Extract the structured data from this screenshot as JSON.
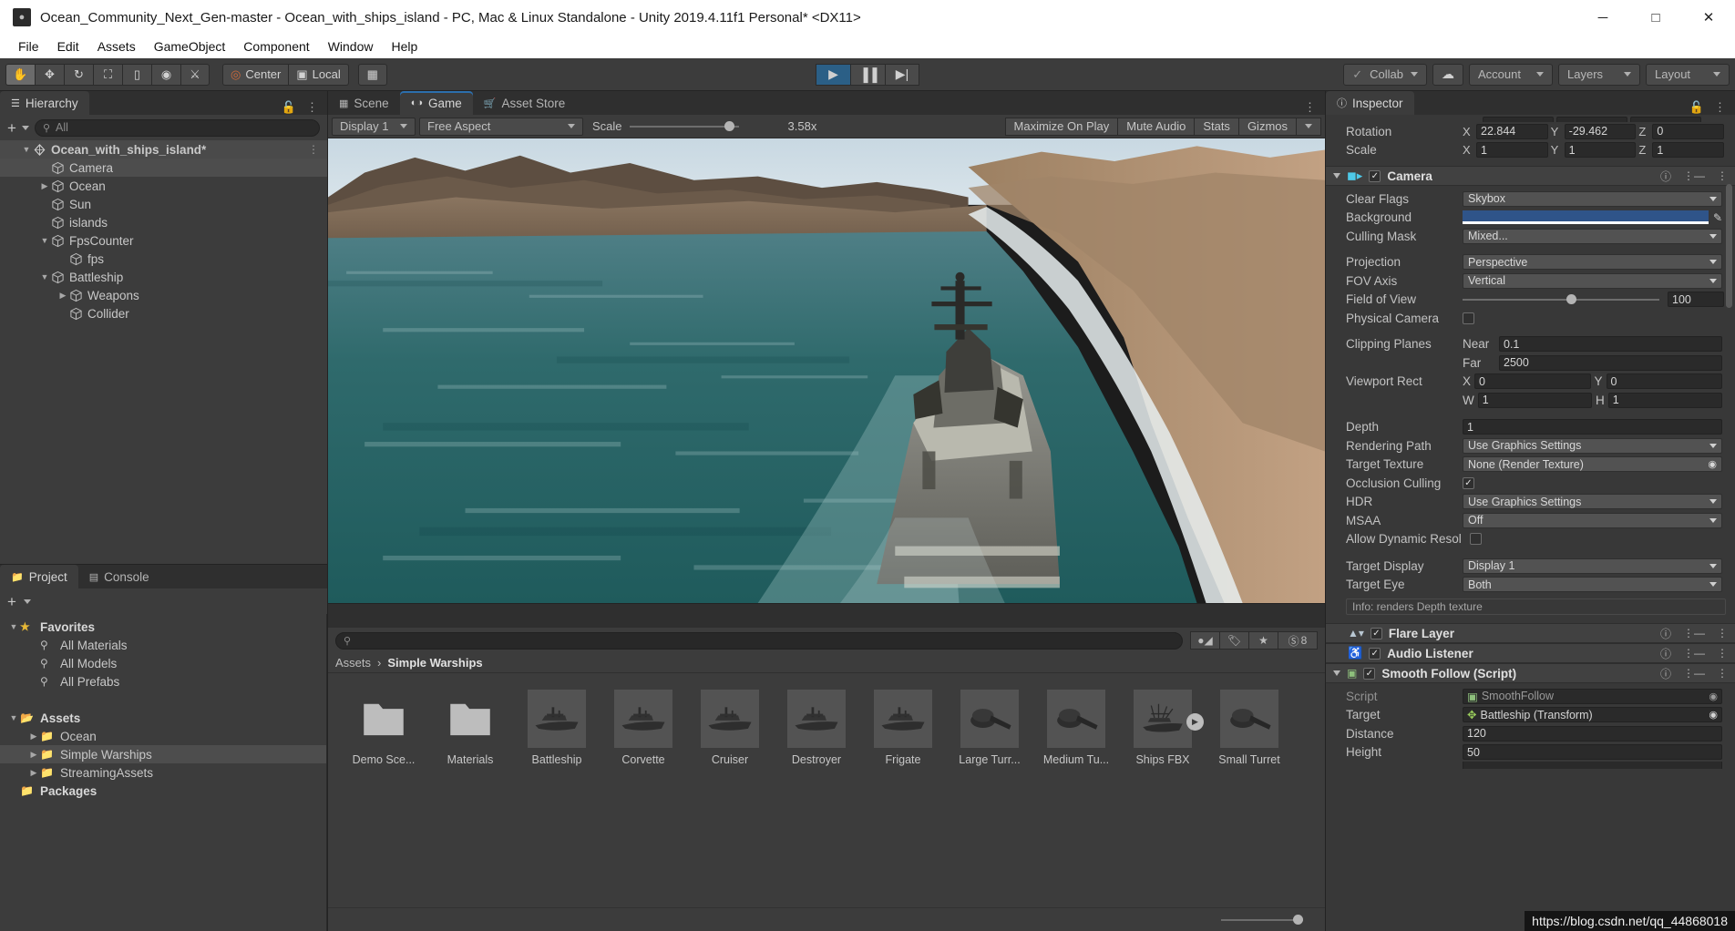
{
  "window": {
    "title": "Ocean_Community_Next_Gen-master - Ocean_with_ships_island - PC, Mac & Linux Standalone - Unity 2019.4.11f1 Personal* <DX11>",
    "minimize": "─",
    "maximize": "□",
    "close": "✕"
  },
  "menubar": {
    "items": [
      "File",
      "Edit",
      "Assets",
      "GameObject",
      "Component",
      "Window",
      "Help"
    ]
  },
  "toolbar": {
    "tools": [
      "hand-tool",
      "move-tool",
      "rotate-tool",
      "scale-tool",
      "rect-tool",
      "transform-tool",
      "custom-tool"
    ],
    "pivot_mode": "Center",
    "pivot_rotation": "Local",
    "grid_label": "",
    "play": "▶",
    "pause": "▐▐",
    "step": "▶|",
    "collab": "Collab",
    "cloud": "cloud",
    "account": "Account",
    "layers": "Layers",
    "layout": "Layout"
  },
  "hierarchy": {
    "tab": "Hierarchy",
    "search_placeholder": "All",
    "items": [
      {
        "label": "Ocean_with_ships_island*",
        "depth": 0,
        "arrow": "down",
        "selected": true,
        "bold": true
      },
      {
        "label": "Camera",
        "depth": 1,
        "arrow": "none",
        "selected": true
      },
      {
        "label": "Ocean",
        "depth": 1,
        "arrow": "right"
      },
      {
        "label": "Sun",
        "depth": 1,
        "arrow": "none"
      },
      {
        "label": "islands",
        "depth": 1,
        "arrow": "none"
      },
      {
        "label": "FpsCounter",
        "depth": 1,
        "arrow": "down"
      },
      {
        "label": "fps",
        "depth": 2,
        "arrow": "none"
      },
      {
        "label": "Battleship",
        "depth": 1,
        "arrow": "down"
      },
      {
        "label": "Weapons",
        "depth": 2,
        "arrow": "right"
      },
      {
        "label": "Collider",
        "depth": 2,
        "arrow": "none"
      }
    ]
  },
  "center_tabs": [
    {
      "label": "Scene",
      "icon": "grid-icon",
      "selected": false
    },
    {
      "label": "Game",
      "icon": "gamepad-icon",
      "selected": true
    },
    {
      "label": "Asset Store",
      "icon": "store-icon",
      "selected": false
    }
  ],
  "game_toolbar": {
    "display": "Display 1",
    "aspect": "Free Aspect",
    "scale_label": "Scale",
    "scale_value": "3.58x",
    "maximize_on_play": "Maximize On Play",
    "mute_audio": "Mute Audio",
    "stats": "Stats",
    "gizmos": "Gizmos"
  },
  "project": {
    "tabs": [
      {
        "label": "Project",
        "icon": "folder-icon",
        "selected": true
      },
      {
        "label": "Console",
        "icon": "console-icon",
        "selected": false
      }
    ],
    "search_placeholder": "",
    "filter_count": "8",
    "tree": [
      {
        "label": "Favorites",
        "depth": 0,
        "arrow": "down",
        "icon": "star",
        "bold": true
      },
      {
        "label": "All Materials",
        "depth": 1,
        "arrow": "none",
        "icon": "search"
      },
      {
        "label": "All Models",
        "depth": 1,
        "arrow": "none",
        "icon": "search"
      },
      {
        "label": "All Prefabs",
        "depth": 1,
        "arrow": "none",
        "icon": "search"
      },
      {
        "label": "",
        "depth": 0,
        "arrow": "none",
        "icon": "none",
        "spacer": true
      },
      {
        "label": "Assets",
        "depth": 0,
        "arrow": "down",
        "icon": "folder-open",
        "bold": true
      },
      {
        "label": "Ocean",
        "depth": 1,
        "arrow": "right",
        "icon": "folder"
      },
      {
        "label": "Simple Warships",
        "depth": 1,
        "arrow": "right",
        "icon": "folder",
        "selected": true
      },
      {
        "label": "StreamingAssets",
        "depth": 1,
        "arrow": "right",
        "icon": "folder"
      },
      {
        "label": "Packages",
        "depth": 0,
        "arrow": "none",
        "icon": "folder",
        "bold": true
      }
    ],
    "breadcrumb": {
      "root": "Assets",
      "sep": "›",
      "current": "Simple Warships"
    },
    "assets": [
      {
        "label": "Demo Sce...",
        "type": "folder"
      },
      {
        "label": "Materials",
        "type": "folder"
      },
      {
        "label": "Battleship",
        "type": "ship"
      },
      {
        "label": "Corvette",
        "type": "ship"
      },
      {
        "label": "Cruiser",
        "type": "ship"
      },
      {
        "label": "Destroyer",
        "type": "ship"
      },
      {
        "label": "Frigate",
        "type": "ship"
      },
      {
        "label": "Large Turr...",
        "type": "turret"
      },
      {
        "label": "Medium Tu...",
        "type": "turret"
      },
      {
        "label": "Ships FBX",
        "type": "fbx",
        "badge": "▶"
      },
      {
        "label": "Small Turret",
        "type": "turret"
      }
    ]
  },
  "inspector": {
    "tab": "Inspector",
    "transform": {
      "rotation": {
        "label": "Rotation",
        "x": "22.844",
        "y": "-29.462",
        "z": "0"
      },
      "scale": {
        "label": "Scale",
        "x": "1",
        "y": "1",
        "z": "1"
      }
    },
    "camera": {
      "name": "Camera",
      "clear_flags": {
        "label": "Clear Flags",
        "value": "Skybox"
      },
      "background": {
        "label": "Background",
        "color": "#2f5489"
      },
      "culling_mask": {
        "label": "Culling Mask",
        "value": "Mixed..."
      },
      "projection": {
        "label": "Projection",
        "value": "Perspective"
      },
      "fov_axis": {
        "label": "FOV Axis",
        "value": "Vertical"
      },
      "field_of_view": {
        "label": "Field of View",
        "value": "100"
      },
      "physical_camera": {
        "label": "Physical Camera",
        "checked": false
      },
      "clipping_planes": {
        "label": "Clipping Planes",
        "near_label": "Near",
        "near": "0.1",
        "far_label": "Far",
        "far": "2500"
      },
      "viewport_rect": {
        "label": "Viewport Rect",
        "x": "0",
        "y": "0",
        "w": "1",
        "h": "1"
      },
      "depth": {
        "label": "Depth",
        "value": "1"
      },
      "rendering_path": {
        "label": "Rendering Path",
        "value": "Use Graphics Settings"
      },
      "target_texture": {
        "label": "Target Texture",
        "value": "None (Render Texture)"
      },
      "occlusion_culling": {
        "label": "Occlusion Culling",
        "checked": true
      },
      "hdr": {
        "label": "HDR",
        "value": "Use Graphics Settings"
      },
      "msaa": {
        "label": "MSAA",
        "value": "Off"
      },
      "allow_dynamic_resolution": {
        "label": "Allow Dynamic Resol",
        "checked": false
      },
      "target_display": {
        "label": "Target Display",
        "value": "Display 1"
      },
      "target_eye": {
        "label": "Target Eye",
        "value": "Both"
      },
      "info": "Info: renders Depth texture"
    },
    "flare_layer": {
      "name": "Flare Layer",
      "checked": true
    },
    "audio_listener": {
      "name": "Audio Listener",
      "checked": true
    },
    "smooth_follow": {
      "name": "Smooth Follow (Script)",
      "script": {
        "label": "Script",
        "value": "SmoothFollow"
      },
      "target": {
        "label": "Target",
        "value": "Battleship (Transform)"
      },
      "distance": {
        "label": "Distance",
        "value": "120"
      },
      "height": {
        "label": "Height",
        "value": "50"
      }
    }
  },
  "watermark": "https://blog.csdn.net/qq_44868018",
  "colors": {
    "accent_blue": "#2c6fad",
    "play_blue": "#2b5f86",
    "bg_panel": "#3c3c3c",
    "bg_dark": "#2f2f2f"
  }
}
